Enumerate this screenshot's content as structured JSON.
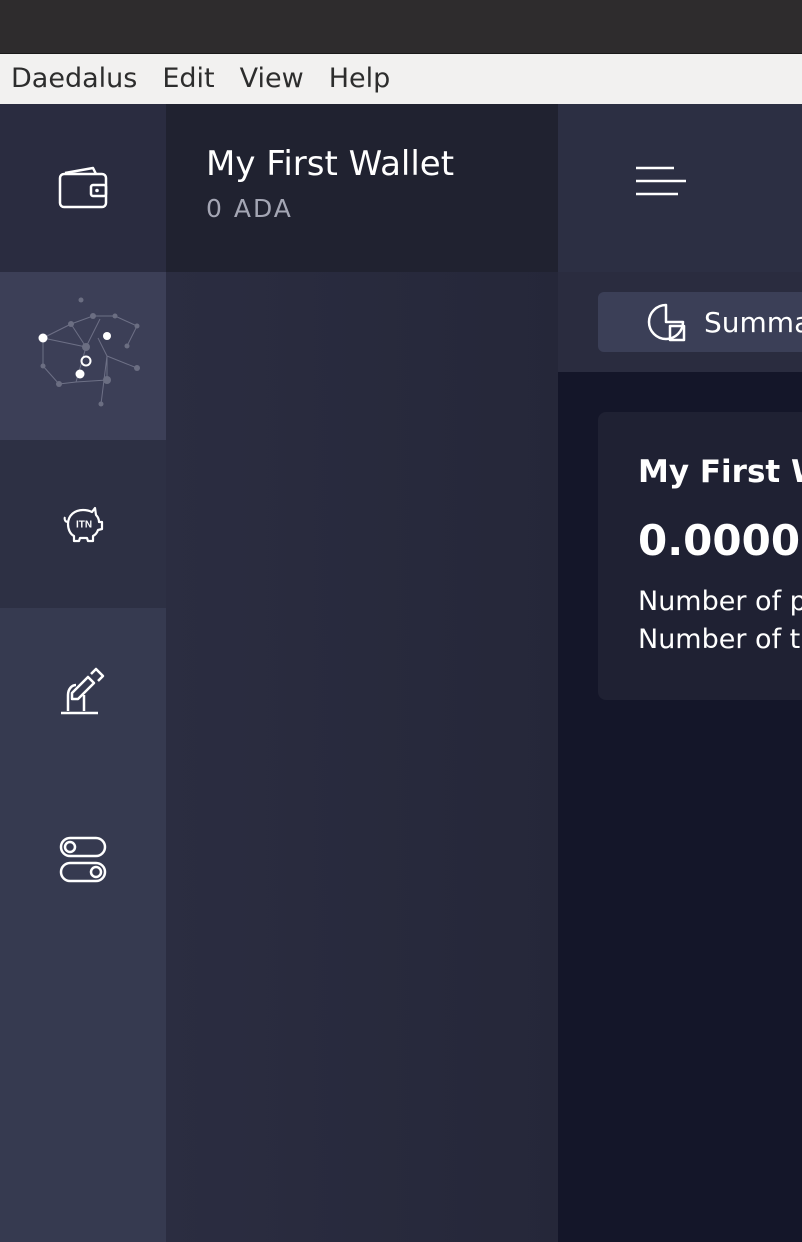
{
  "menu": {
    "items": [
      "Daedalus",
      "Edit",
      "View",
      "Help"
    ]
  },
  "sidebar": {
    "items": [
      {
        "id": "wallets",
        "icon": "wallet-icon"
      },
      {
        "id": "network",
        "icon": "network-icon"
      },
      {
        "id": "itn",
        "icon": "itn-piggy-icon",
        "badge": "ITN"
      },
      {
        "id": "voting",
        "icon": "voting-icon"
      },
      {
        "id": "settings",
        "icon": "settings-toggle-icon"
      }
    ]
  },
  "wallet_list": {
    "items": [
      {
        "name": "My First Wallet",
        "balance": "0 ADA"
      }
    ]
  },
  "topbar": {
    "menu_icon": "hamburger-menu-icon"
  },
  "navigation": {
    "active_tab": {
      "label": "Summa",
      "icon": "summary-pie-icon"
    }
  },
  "summary": {
    "wallet_name": "My First W",
    "amount": "0.00000",
    "line1": "Number of p",
    "line2": "Number of t"
  },
  "colors": {
    "titlebar": "#2e2c2d",
    "menubar": "#f2f1f0",
    "sidebar": "#363a50",
    "sidebar_active_wallets": "#2a2c40",
    "sidebar_active_network": "#3c3f57",
    "sidebar_itn": "#2d3044",
    "wallet_panel": "#2b2d41",
    "wallet_item": "#202230",
    "content_bg": "#141629",
    "card_bg": "#1f2133"
  }
}
